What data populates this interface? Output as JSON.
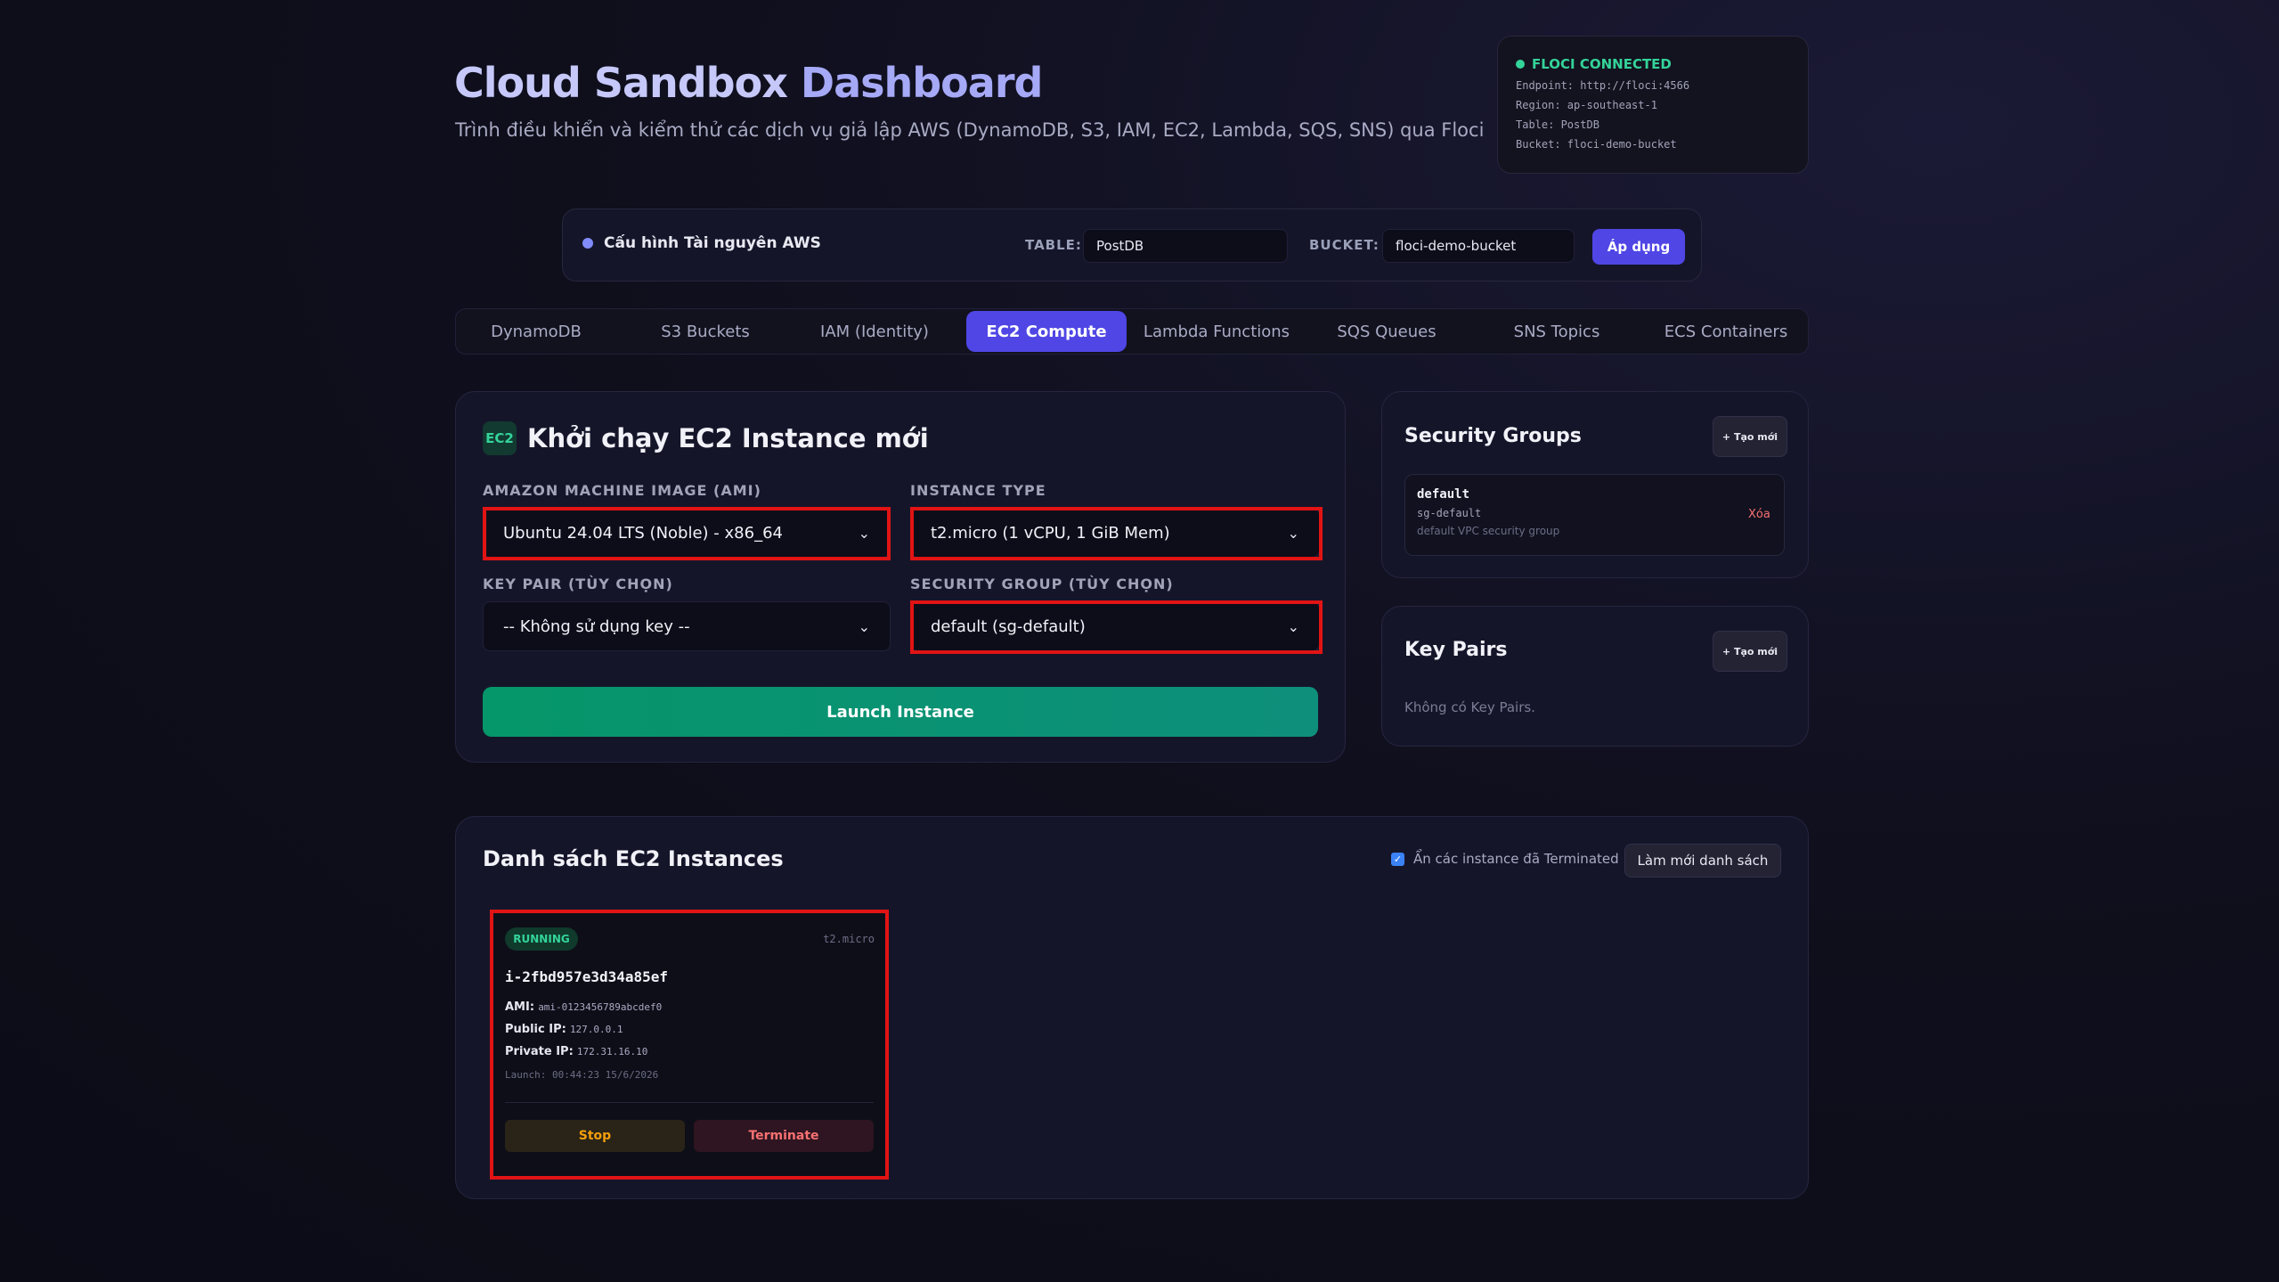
{
  "header": {
    "title_part1": "Cloud Sandbox",
    "title_part2": "Dashboard",
    "subtitle": "Trình điều khiển và kiểm thử các dịch vụ giả lập AWS (DynamoDB, S3, IAM, EC2, Lambda, SQS, SNS) qua Floci"
  },
  "status": {
    "label": "FLOCI CONNECTED",
    "endpoint": "Endpoint: http://floci:4566",
    "region": "Region: ap-southeast-1",
    "table": "Table: PostDB",
    "bucket": "Bucket: floci-demo-bucket",
    "color": "#34d399"
  },
  "config": {
    "label": "Cấu hình Tài nguyên AWS",
    "table_label": "TABLE:",
    "table_value": "PostDB",
    "bucket_label": "BUCKET:",
    "bucket_value": "floci-demo-bucket",
    "apply_label": "Áp dụng"
  },
  "tabs": [
    {
      "label": "DynamoDB"
    },
    {
      "label": "S3 Buckets"
    },
    {
      "label": "IAM (Identity)"
    },
    {
      "label": "EC2 Compute",
      "active": true
    },
    {
      "label": "Lambda Functions"
    },
    {
      "label": "SQS Queues"
    },
    {
      "label": "SNS Topics"
    },
    {
      "label": "ECS Containers"
    }
  ],
  "launch": {
    "badge": "EC2",
    "title": "Khởi chạy EC2 Instance mới",
    "ami_label": "AMAZON MACHINE IMAGE (AMI)",
    "ami_value": "Ubuntu 24.04 LTS (Noble) - x86_64",
    "type_label": "INSTANCE TYPE",
    "type_value": "t2.micro (1 vCPU, 1 GiB Mem)",
    "key_label": "KEY PAIR (TÙY CHỌN)",
    "key_value": "-- Không sử dụng key --",
    "sg_label": "SECURITY GROUP (TÙY CHỌN)",
    "sg_value": "default (sg-default)",
    "button": "Launch Instance"
  },
  "security_groups": {
    "title": "Security Groups",
    "create_label": "+ Tạo mới",
    "items": [
      {
        "name": "default",
        "id": "sg-default",
        "description": "default VPC security group",
        "delete_label": "Xóa"
      }
    ]
  },
  "key_pairs": {
    "title": "Key Pairs",
    "create_label": "+ Tạo mới",
    "empty_text": "Không có Key Pairs."
  },
  "instances": {
    "title": "Danh sách EC2 Instances",
    "hide_terminated_label": "Ẩn các instance đã Terminated",
    "hide_terminated_checked": true,
    "refresh_label": "Làm mới danh sách",
    "items": [
      {
        "state": "RUNNING",
        "type": "t2.micro",
        "id": "i-2fbd957e3d34a85ef",
        "ami_label": "AMI:",
        "ami": "ami-0123456789abcdef0",
        "public_ip_label": "Public IP:",
        "public_ip": "127.0.0.1",
        "private_ip_label": "Private IP:",
        "private_ip": "172.31.16.10",
        "launch": "Launch: 00:44:23 15/6/2026",
        "stop_label": "Stop",
        "terminate_label": "Terminate"
      }
    ]
  },
  "colors": {
    "accent": "#4f46e5",
    "success": "#34d399",
    "danger": "#f87171",
    "warning": "#f59e0b",
    "highlight": "#e11414"
  }
}
